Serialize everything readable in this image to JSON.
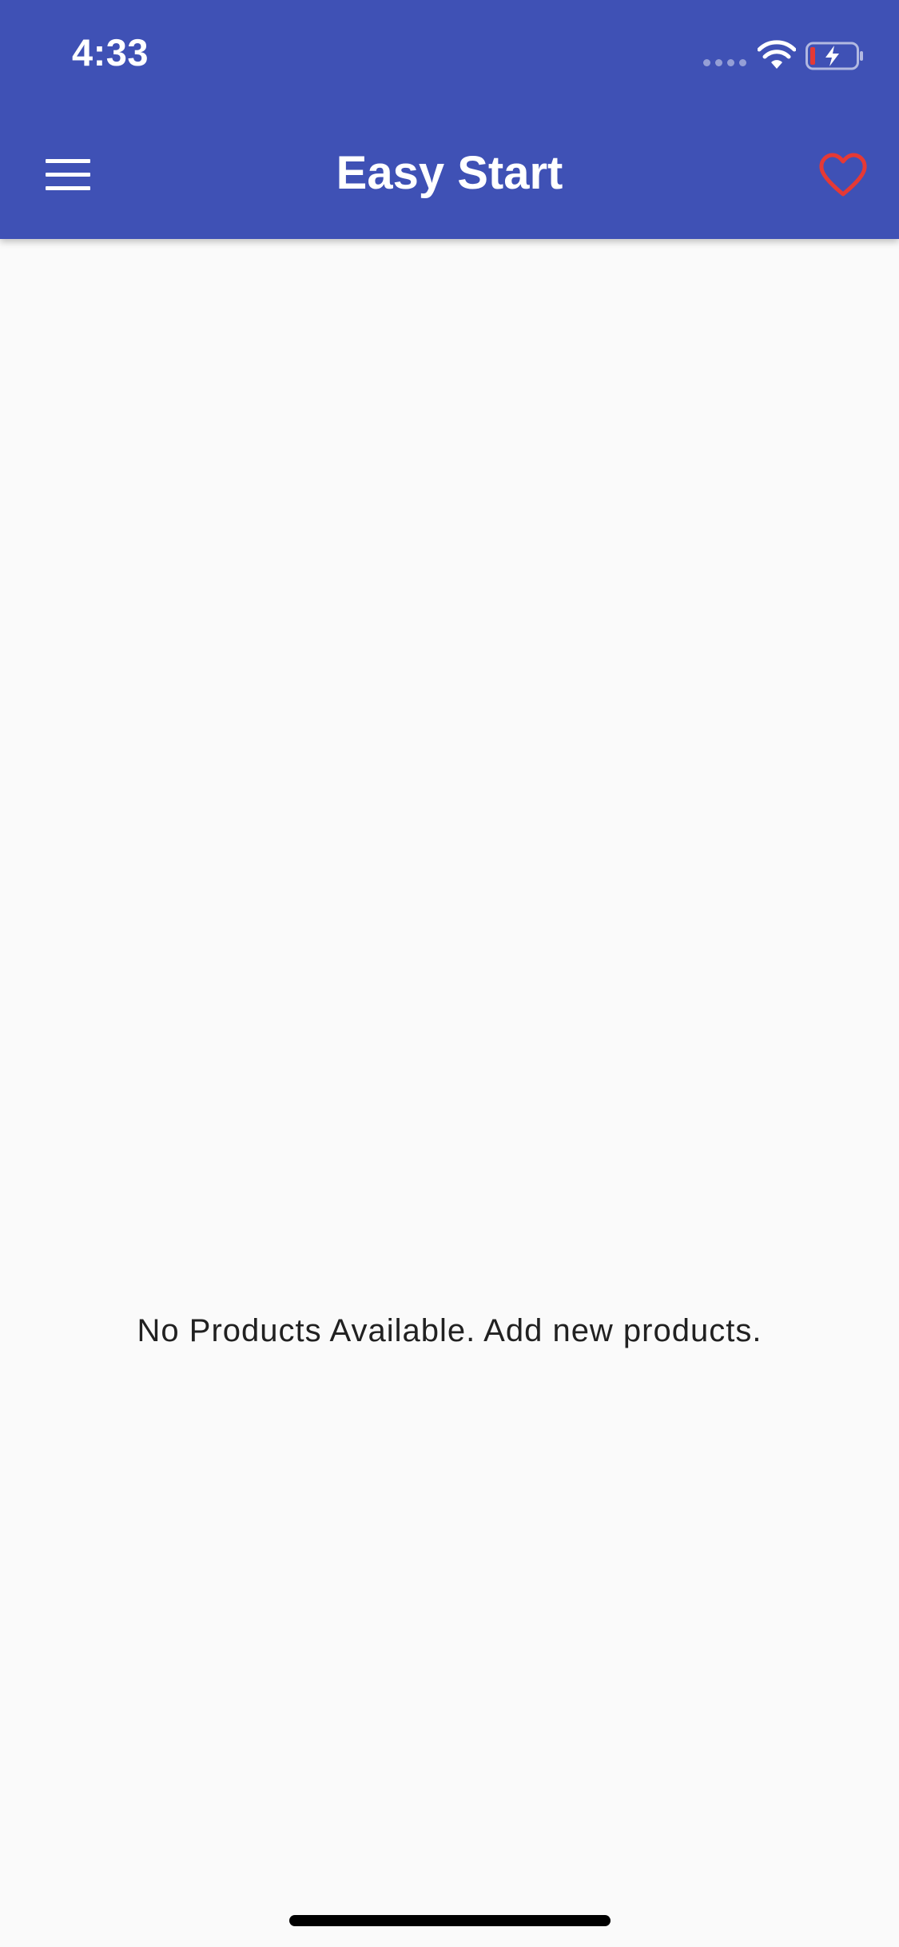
{
  "status_bar": {
    "time": "4:33",
    "icons": [
      "signal-icon",
      "wifi-icon",
      "battery-charging-icon"
    ]
  },
  "app_bar": {
    "title": "Easy Start",
    "menu_icon": "menu-icon",
    "favorite_icon": "heart-outline-icon"
  },
  "main": {
    "empty_message": "No Products Available. Add new products."
  },
  "colors": {
    "primary": "#3f51b5",
    "favorite": "#e53935",
    "background": "#fafafa",
    "text": "#212121",
    "battery_low": "#e53935"
  }
}
